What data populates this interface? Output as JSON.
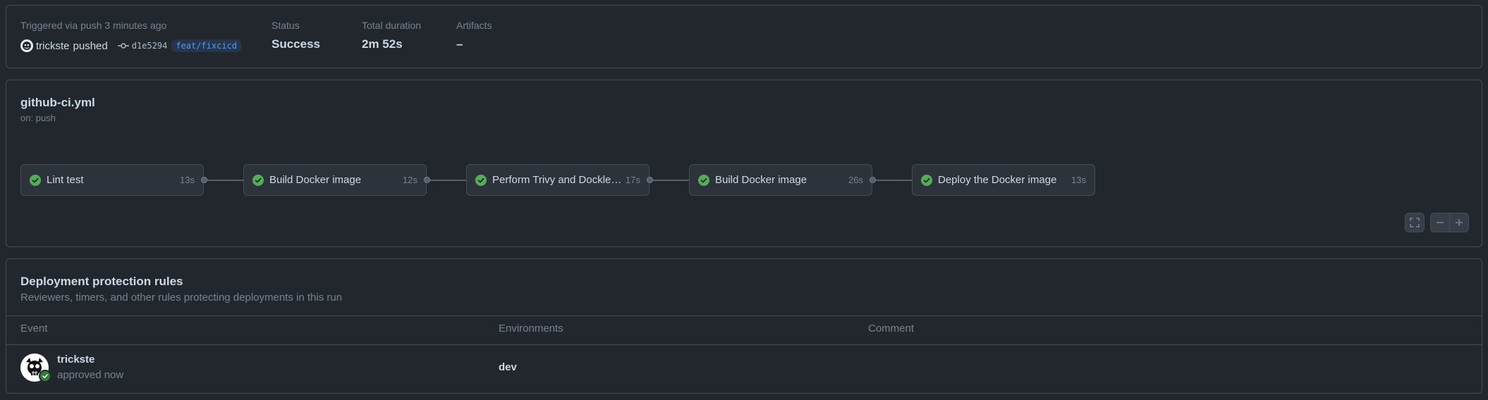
{
  "summary": {
    "trigger_text": "Triggered via push 3 minutes ago",
    "actor": "trickste",
    "action": "pushed",
    "commit_sha": "d1e5294",
    "branch": "feat/fixcicd",
    "status_label": "Status",
    "status_value": "Success",
    "duration_label": "Total duration",
    "duration_value": "2m 52s",
    "artifacts_label": "Artifacts",
    "artifacts_value": "–"
  },
  "workflow": {
    "file": "github-ci.yml",
    "trigger": "on: push",
    "jobs": [
      {
        "name": "Lint test",
        "duration": "13s",
        "status": "success"
      },
      {
        "name": "Build Docker image",
        "duration": "12s",
        "status": "success"
      },
      {
        "name": "Perform Trivy and Dockle t...",
        "duration": "17s",
        "status": "success"
      },
      {
        "name": "Build Docker image",
        "duration": "26s",
        "status": "success"
      },
      {
        "name": "Deploy the Docker image",
        "duration": "13s",
        "status": "success"
      }
    ],
    "controls": {
      "fullscreen_icon": "fullscreen-icon",
      "zoom_out_icon": "minus-icon",
      "zoom_in_icon": "plus-icon"
    }
  },
  "protection": {
    "title": "Deployment protection rules",
    "subtitle": "Reviewers, timers, and other rules protecting deployments in this run",
    "columns": {
      "event": "Event",
      "environments": "Environments",
      "comment": "Comment"
    },
    "rows": [
      {
        "reviewer": "trickste",
        "status": "approved now",
        "environment": "dev",
        "comment": ""
      }
    ]
  },
  "colors": {
    "background": "#22272e",
    "border": "#444c56",
    "success": "#57ab5a",
    "accent": "#539bf5"
  }
}
